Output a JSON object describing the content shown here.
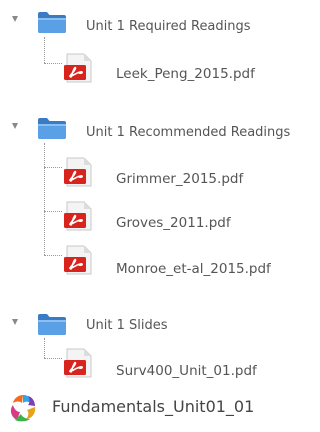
{
  "tree": {
    "folders": [
      {
        "label": "Unit 1 Required Readings",
        "icon": "folder-icon",
        "expanded": true,
        "files": [
          {
            "label": "Leek_Peng_2015.pdf",
            "icon": "pdf-icon"
          }
        ]
      },
      {
        "label": "Unit 1 Recommended Readings",
        "icon": "folder-icon",
        "expanded": true,
        "files": [
          {
            "label": "Grimmer_2015.pdf",
            "icon": "pdf-icon"
          },
          {
            "label": "Groves_2011.pdf",
            "icon": "pdf-icon"
          },
          {
            "label": "Monroe_et-al_2015.pdf",
            "icon": "pdf-icon"
          }
        ]
      },
      {
        "label": "Unit 1 Slides",
        "icon": "folder-icon",
        "expanded": true,
        "files": [
          {
            "label": "Surv400_Unit_01.pdf",
            "icon": "pdf-icon"
          }
        ]
      }
    ],
    "extra_item": {
      "label": "Fundamentals_Unit01_01",
      "icon": "multimedia-package-icon"
    }
  },
  "colors": {
    "folder": "#4a8fd6",
    "pdf": "#e2231a",
    "text": "#555555"
  }
}
